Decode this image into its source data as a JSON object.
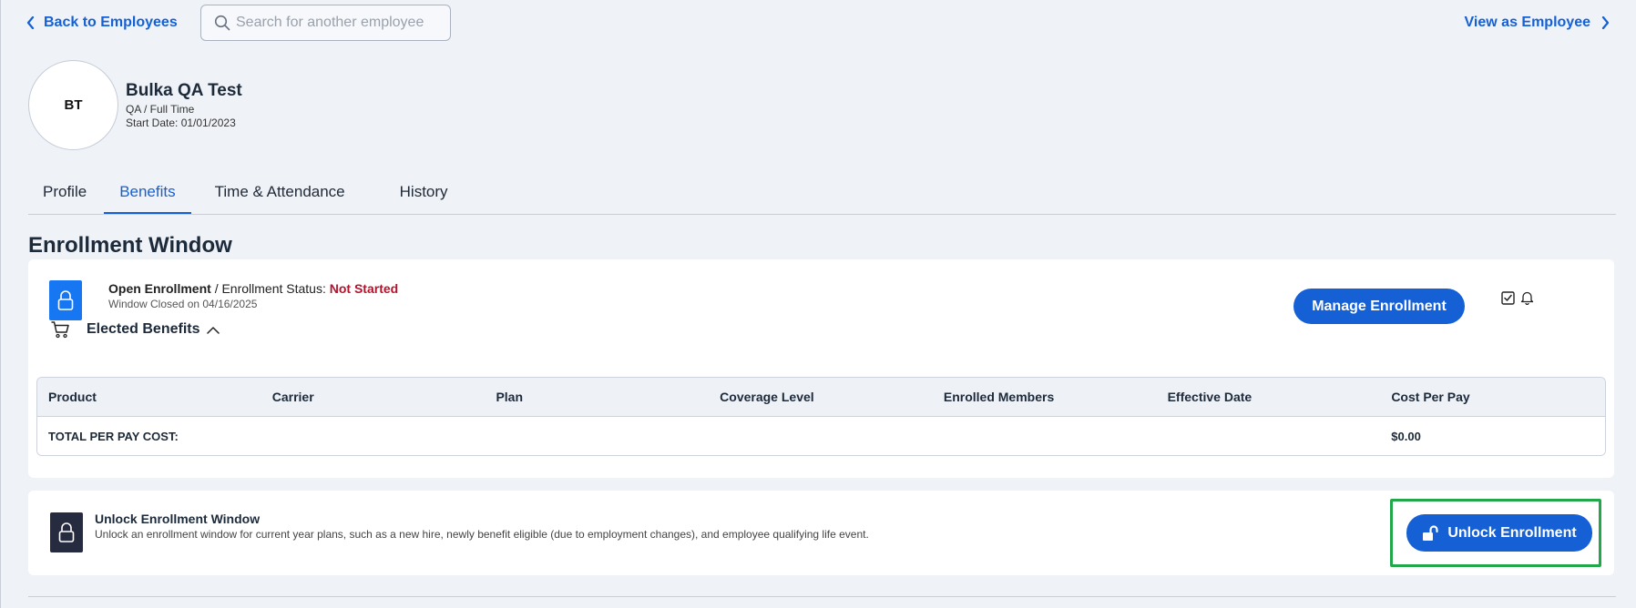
{
  "nav": {
    "back_label": "Back to Employees",
    "search_placeholder": "Search for another employee",
    "view_as_label": "View as Employee"
  },
  "employee": {
    "initials": "BT",
    "name": "Bulka QA Test",
    "role": "QA / Full Time",
    "start_date": "Start Date: 01/01/2023"
  },
  "tabs": [
    {
      "label": "Profile",
      "active": false
    },
    {
      "label": "Benefits",
      "active": true
    },
    {
      "label": "Time & Attendance",
      "active": false
    },
    {
      "label": "History",
      "active": false
    }
  ],
  "section_title": "Enrollment Window",
  "enrollment": {
    "type": "Open Enrollment",
    "status_prefix": "/ Enrollment Status: ",
    "status": "Not Started",
    "window_note": "Window Closed on 04/16/2025",
    "manage_label": "Manage Enrollment",
    "elected_label": "Elected Benefits",
    "table": {
      "headers": [
        "Product",
        "Carrier",
        "Plan",
        "Coverage Level",
        "Enrolled Members",
        "Effective Date",
        "Cost Per Pay"
      ],
      "total_label": "TOTAL PER PAY COST:",
      "total_value": "$0.00"
    }
  },
  "unlock": {
    "title": "Unlock Enrollment Window",
    "description": "Unlock an enrollment window for current year plans, such as a new hire, newly benefit eligible (due to employment changes), and employee qualifying life event.",
    "button_label": "Unlock Enrollment"
  },
  "colors": {
    "accent": "#1560d4",
    "status_not_started": "#b3132b",
    "lock_tile_blue": "#1777f2",
    "lock_tile_dark": "#262b3f",
    "highlight": "#22a84a"
  },
  "icons": [
    "chevron-left-icon",
    "search-icon",
    "chevron-right-icon",
    "lock-icon",
    "cart-icon",
    "chevron-up-icon",
    "checkbox-icon",
    "bell-icon",
    "unlock-icon"
  ]
}
